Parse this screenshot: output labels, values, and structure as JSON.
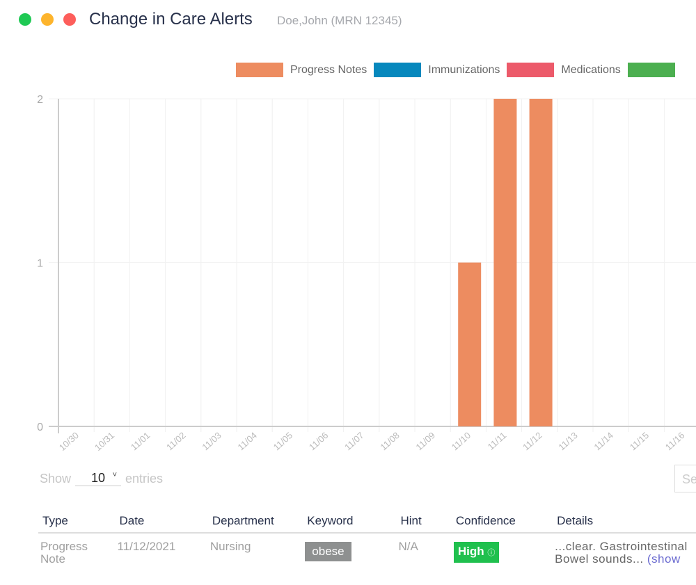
{
  "window": {
    "controls": [
      {
        "name": "maximize",
        "color": "#1fc954"
      },
      {
        "name": "minimize",
        "color": "#fdb42c"
      },
      {
        "name": "close",
        "color": "#fd5e5b"
      }
    ],
    "title": "Change in Care Alerts",
    "subtitle": "Doe,John (MRN 12345)"
  },
  "chart_data": {
    "type": "bar",
    "title": "",
    "xlabel": "",
    "ylabel": "",
    "ylim": [
      0,
      2
    ],
    "yticks": [
      "0",
      "1",
      "2"
    ],
    "grid": true,
    "legend_position": "top-right",
    "categories": [
      "10/30",
      "10/31",
      "11/01",
      "11/02",
      "11/03",
      "11/04",
      "11/05",
      "11/06",
      "11/07",
      "11/08",
      "11/09",
      "11/10",
      "11/11",
      "11/12",
      "11/13",
      "11/14",
      "11/15",
      "11/16"
    ],
    "series": [
      {
        "name": "Progress Notes",
        "color": "#ed8c60",
        "values": [
          0,
          0,
          0,
          0,
          0,
          0,
          0,
          0,
          0,
          0,
          0,
          1,
          2,
          2,
          0,
          0,
          0,
          0
        ]
      },
      {
        "name": "Immunizations",
        "color": "#0788bd",
        "values": [
          0,
          0,
          0,
          0,
          0,
          0,
          0,
          0,
          0,
          0,
          0,
          0,
          0,
          0,
          0,
          0,
          0,
          0
        ]
      },
      {
        "name": "Medications",
        "color": "#ec5a6a",
        "values": [
          0,
          0,
          0,
          0,
          0,
          0,
          0,
          0,
          0,
          0,
          0,
          0,
          0,
          0,
          0,
          0,
          0,
          0
        ]
      },
      {
        "name": "",
        "color": "#4caf50",
        "values": [
          0,
          0,
          0,
          0,
          0,
          0,
          0,
          0,
          0,
          0,
          0,
          0,
          0,
          0,
          0,
          0,
          0,
          0
        ]
      }
    ]
  },
  "table_controls": {
    "show_label": "Show",
    "entries_value": "10",
    "entries_label": "entries",
    "search_placeholder": "Se"
  },
  "table": {
    "headers": [
      "Type",
      "Date",
      "Department",
      "Keyword",
      "Hint",
      "Confidence",
      "Details"
    ],
    "rows": [
      {
        "type": "Progress Note",
        "date": "11/12/2021",
        "department": "Nursing",
        "keyword": "obese",
        "hint": "N/A",
        "confidence": "High",
        "details_line1": "...clear. Gastrointestinal",
        "details_line2": "Bowel sounds...",
        "details_link": "(show"
      }
    ]
  }
}
